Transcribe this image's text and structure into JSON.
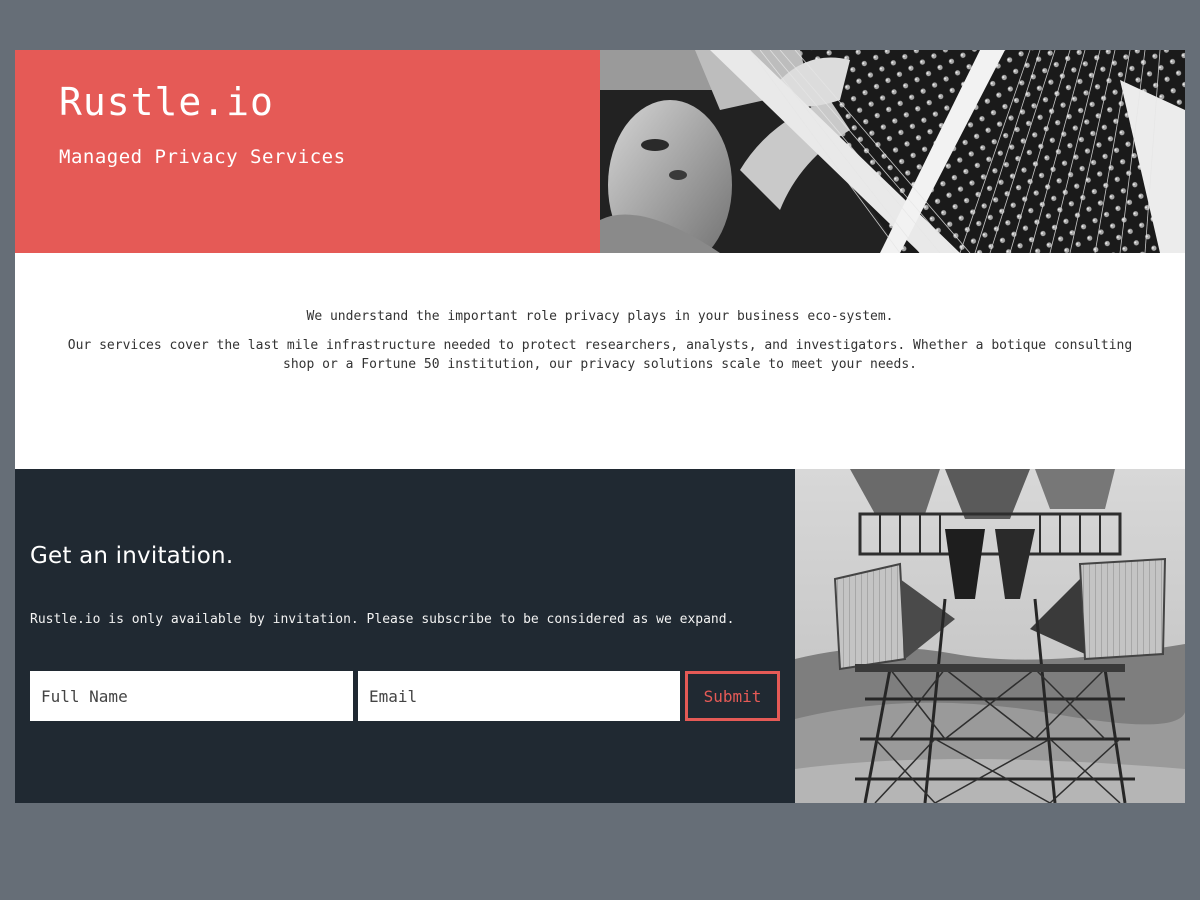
{
  "header": {
    "brand_title": "Rustle.io",
    "tagline": "Managed Privacy Services",
    "photo_icon": "technician-wiring-photo"
  },
  "intro": {
    "line1": "We understand the important role privacy plays in your business eco-system.",
    "line2": "Our services cover the last mile infrastructure needed to protect researchers, analysts, and investigators. Whether a botique consulting shop or a Fortune 50 institution, our privacy solutions scale to meet your needs."
  },
  "invite": {
    "heading": "Get an invitation.",
    "text": "Rustle.io is only available by invitation. Please subscribe to be considered as we expand.",
    "name_placeholder": "Full Name",
    "email_placeholder": "Email",
    "submit_label": "Submit",
    "photo_icon": "radio-tower-photo"
  },
  "colors": {
    "accent": "#e55a56",
    "dark_panel": "#202932",
    "page_background": "#666e77"
  }
}
